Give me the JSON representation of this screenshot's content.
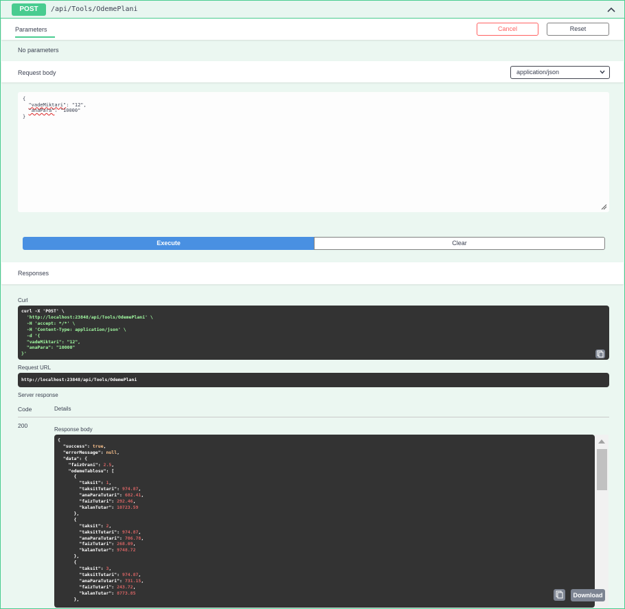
{
  "operation": {
    "method": "POST",
    "path": "/api/Tools/OdemePlani"
  },
  "parameters": {
    "tab_label": "Parameters",
    "cancel_label": "Cancel",
    "reset_label": "Reset",
    "no_params_text": "No parameters"
  },
  "request_body": {
    "label": "Request body",
    "content_type": "application/json",
    "editor_open": "{",
    "editor_vade_key": "\"vadeMiktari\"",
    "editor_vade_val": ": \"12\",",
    "editor_ana_key": "\"anaPara\"",
    "editor_ana_val": ": \"10000\"",
    "editor_close": "}"
  },
  "actions": {
    "execute_label": "Execute",
    "clear_label": "Clear"
  },
  "responses": {
    "title": "Responses",
    "curl_label": "Curl",
    "curl_lines": [
      "curl -X 'POST' \\",
      "  'http://localhost:23848/api/Tools/OdemePlani' \\",
      "  -H 'accept: */*' \\",
      "  -H 'Content-Type: application/json' \\",
      "  -d '{",
      "  \"vadeMiktari\": \"12\",",
      "  \"anaPara\": \"10000\"",
      "}'"
    ],
    "request_url_label": "Request URL",
    "request_url": "http://localhost:23848/api/Tools/OdemePlani",
    "server_response_label": "Server response",
    "code_header": "Code",
    "details_header": "Details",
    "status_code": "200",
    "response_body_label": "Response body",
    "download_label": "Download",
    "body": {
      "success": "true",
      "errorMessage": "null",
      "faizOrani": "2.5",
      "rows": [
        {
          "taksit": "1",
          "taksitTutari": "974.87",
          "anaParaTutari": "682.41",
          "faizTutari": "292.46",
          "kalanTutar": "10723.59"
        },
        {
          "taksit": "2",
          "taksitTutari": "974.87",
          "anaParaTutari": "706.78",
          "faizTutari": "268.09",
          "kalanTutar": "9748.72"
        },
        {
          "taksit": "3",
          "taksitTutari": "974.87",
          "anaParaTutari": "731.15",
          "faizTutari": "243.72",
          "kalanTutar": "8773.85"
        }
      ]
    }
  },
  "colors": {
    "accent": "#49cc90",
    "execute": "#4990e2",
    "cancel": "#ff6060",
    "code_bg": "#333333"
  },
  "icons": [
    "chevron-up-icon",
    "chevron-down-icon",
    "resize-grip-icon",
    "copy-icon"
  ]
}
